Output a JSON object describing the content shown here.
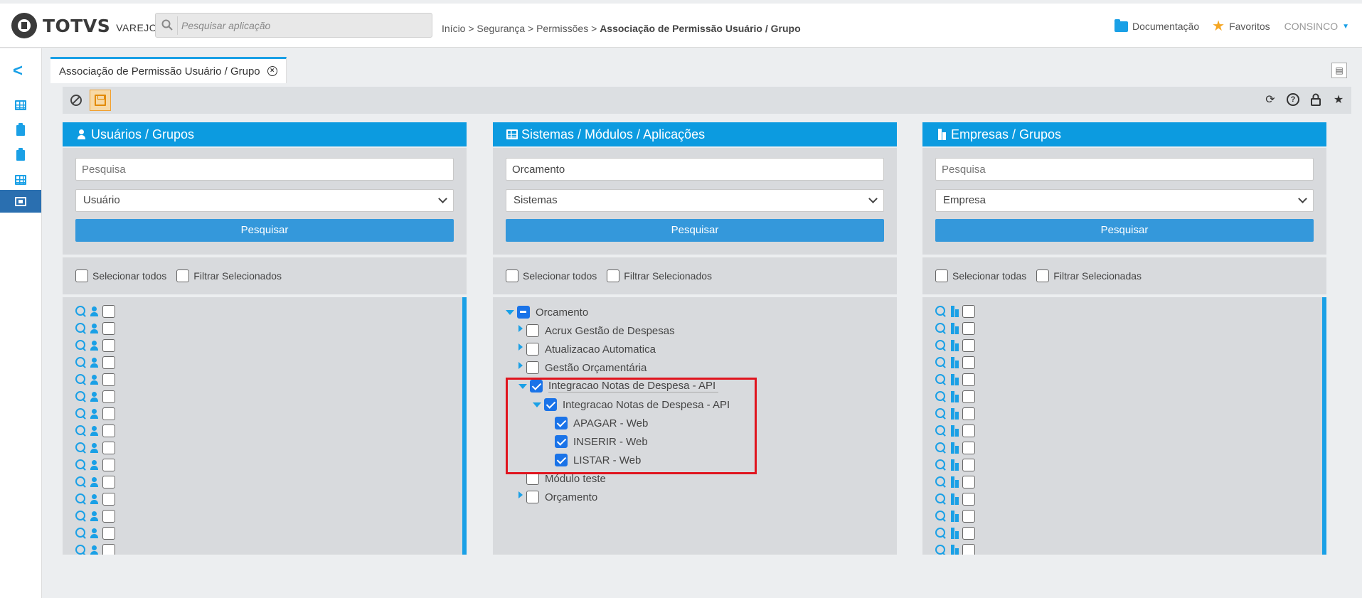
{
  "brand": {
    "name": "TOTVS",
    "sub": "VAREJO"
  },
  "search": {
    "placeholder": "Pesquisar aplicação"
  },
  "breadcrumb": {
    "path": "Início > Segurança > Permissões > ",
    "current": "Associação de Permissão Usuário / Grupo"
  },
  "header_links": {
    "docs": "Documentação",
    "favorites": "Favoritos",
    "user": "CONSINCO"
  },
  "tab": {
    "title": "Associação de Permissão Usuário / Grupo"
  },
  "panels": {
    "users": {
      "title": "Usuários / Grupos",
      "search_placeholder": "Pesquisa",
      "select_value": "Usuário",
      "button": "Pesquisar",
      "select_all": "Selecionar todos",
      "filter_selected": "Filtrar Selecionados",
      "row_count": 15
    },
    "systems": {
      "title": "Sistemas / Módulos / Aplicações",
      "search_value": "Orcamento",
      "select_value": "Sistemas",
      "button": "Pesquisar",
      "select_all": "Selecionar todos",
      "filter_selected": "Filtrar Selecionados",
      "tree": [
        {
          "label": "Orcamento",
          "expander": "open",
          "state": "partial",
          "level": 0
        },
        {
          "label": "Acrux Gestão de Despesas",
          "expander": "closed",
          "state": "unchecked",
          "level": 1
        },
        {
          "label": "Atualizacao Automatica",
          "expander": "closed",
          "state": "unchecked",
          "level": 1
        },
        {
          "label": "Gestão Orçamentária",
          "expander": "closed",
          "state": "unchecked",
          "level": 1
        },
        {
          "label": "Integracao Notas de Despesa - API",
          "expander": "open",
          "state": "checked",
          "level": 1
        },
        {
          "label": "Integracao Notas de Despesa - API",
          "expander": "open",
          "state": "checked",
          "level": 2
        },
        {
          "label": "APAGAR - Web",
          "expander": "none",
          "state": "checked",
          "level": 3
        },
        {
          "label": "INSERIR - Web",
          "expander": "none",
          "state": "checked",
          "level": 3
        },
        {
          "label": "LISTAR - Web",
          "expander": "none",
          "state": "checked",
          "level": 3
        },
        {
          "label": "Módulo teste",
          "expander": "none",
          "state": "unchecked",
          "level": 1
        },
        {
          "label": "Orçamento",
          "expander": "closed",
          "state": "unchecked",
          "level": 1
        }
      ]
    },
    "companies": {
      "title": "Empresas / Grupos",
      "search_placeholder": "Pesquisa",
      "select_value": "Empresa",
      "button": "Pesquisar",
      "select_all": "Selecionar todas",
      "filter_selected": "Filtrar Selecionadas",
      "row_count": 15
    }
  },
  "colors": {
    "accent": "#0c9be0",
    "button": "#3498db",
    "highlight_box": "#e0141e",
    "save_button": "#f7d9a6"
  }
}
